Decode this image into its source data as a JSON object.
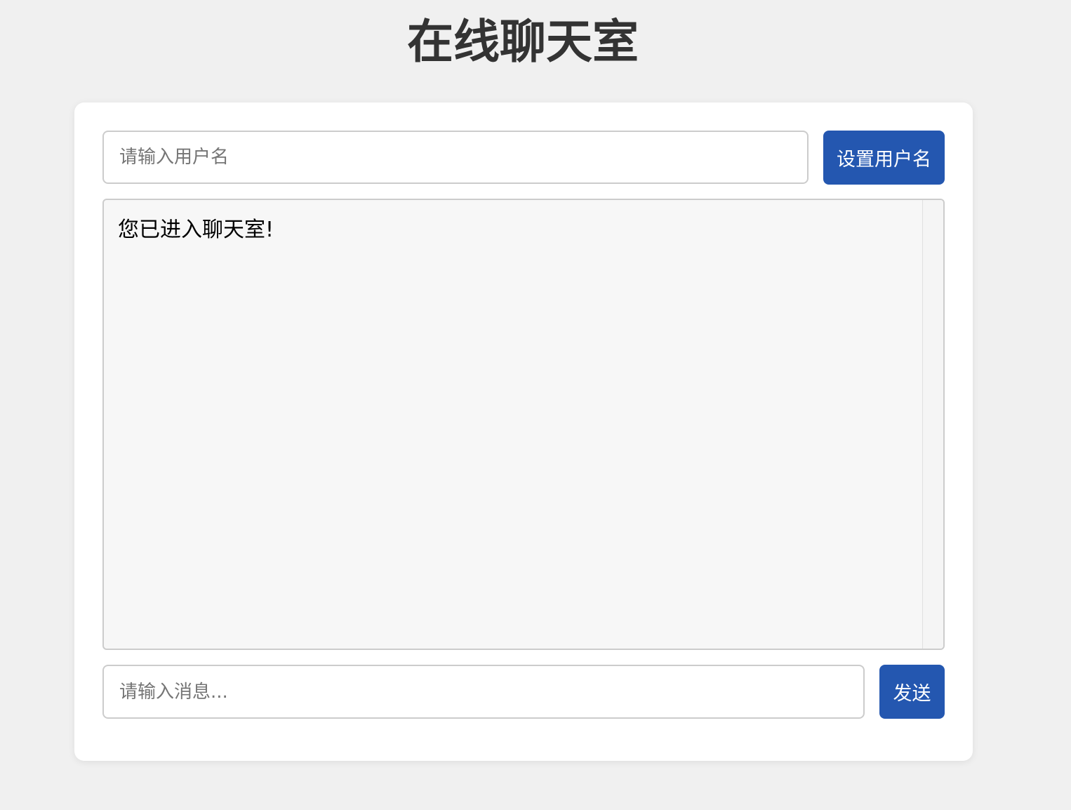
{
  "page": {
    "title": "在线聊天室"
  },
  "username": {
    "placeholder": "请输入用户名",
    "value": "",
    "button_label": "设置用户名"
  },
  "messages": {
    "items": [
      {
        "text": "您已进入聊天室!"
      }
    ]
  },
  "composer": {
    "placeholder": "请输入消息...",
    "value": "",
    "send_label": "发送"
  },
  "colors": {
    "accent": "#2457b0",
    "background": "#f0f0f0",
    "card": "#ffffff",
    "message_area": "#f7f7f7",
    "title_text": "#333333"
  }
}
